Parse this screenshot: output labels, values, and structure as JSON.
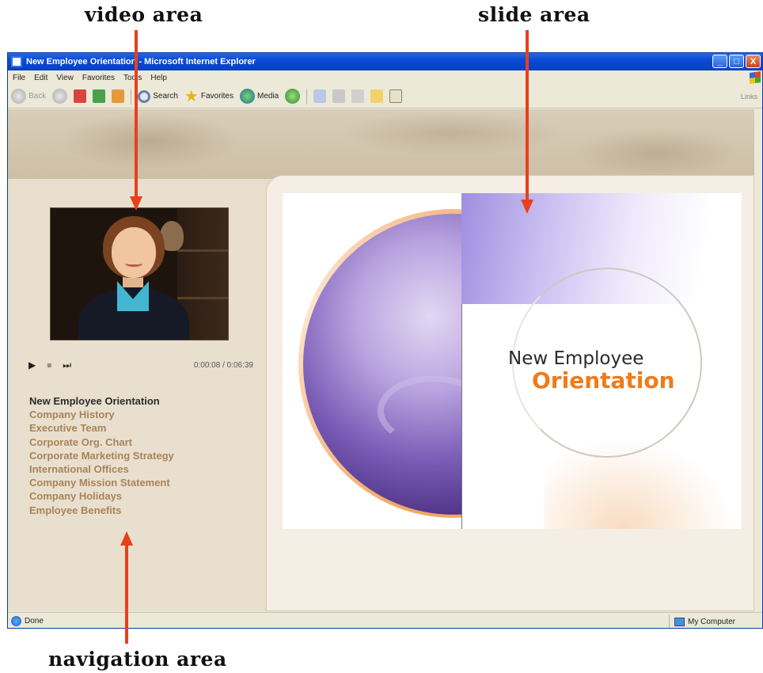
{
  "callouts": {
    "video": "video area",
    "slide": "slide area",
    "navigation": "navigation area"
  },
  "window": {
    "title": "New Employee Orientation - Microsoft Internet Explorer",
    "buttons": [
      "_",
      "□",
      "X"
    ]
  },
  "menu": [
    "File",
    "Edit",
    "View",
    "Favorites",
    "Tools",
    "Help"
  ],
  "toolbar": {
    "back_label": "Back",
    "search_label": "Search",
    "favorites_label": "Favorites",
    "media_label": "Media",
    "go_label": "Links"
  },
  "player": {
    "play_icon": "play-icon",
    "stop_icon": "stop-icon",
    "next_icon": "skip-icon",
    "timecode": "0:00:08 / 0:06:39"
  },
  "navigation": {
    "items": [
      "New Employee Orientation",
      "Company History",
      "Executive Team",
      "Corporate Org. Chart",
      "Corporate Marketing Strategy",
      "International Offices",
      "Company Mission Statement",
      "Company Holidays",
      "Employee Benefits"
    ],
    "current_index": 0
  },
  "slide": {
    "title_line1": "New Employee",
    "title_line2": "Orientation"
  },
  "status": {
    "left": "Done",
    "zone": "My Computer"
  },
  "colors": {
    "arrow": "#e8401c",
    "title_orange": "#ef7b1a",
    "nav_link": "#a88256",
    "xp_titlebar": "#0a4bd6"
  }
}
